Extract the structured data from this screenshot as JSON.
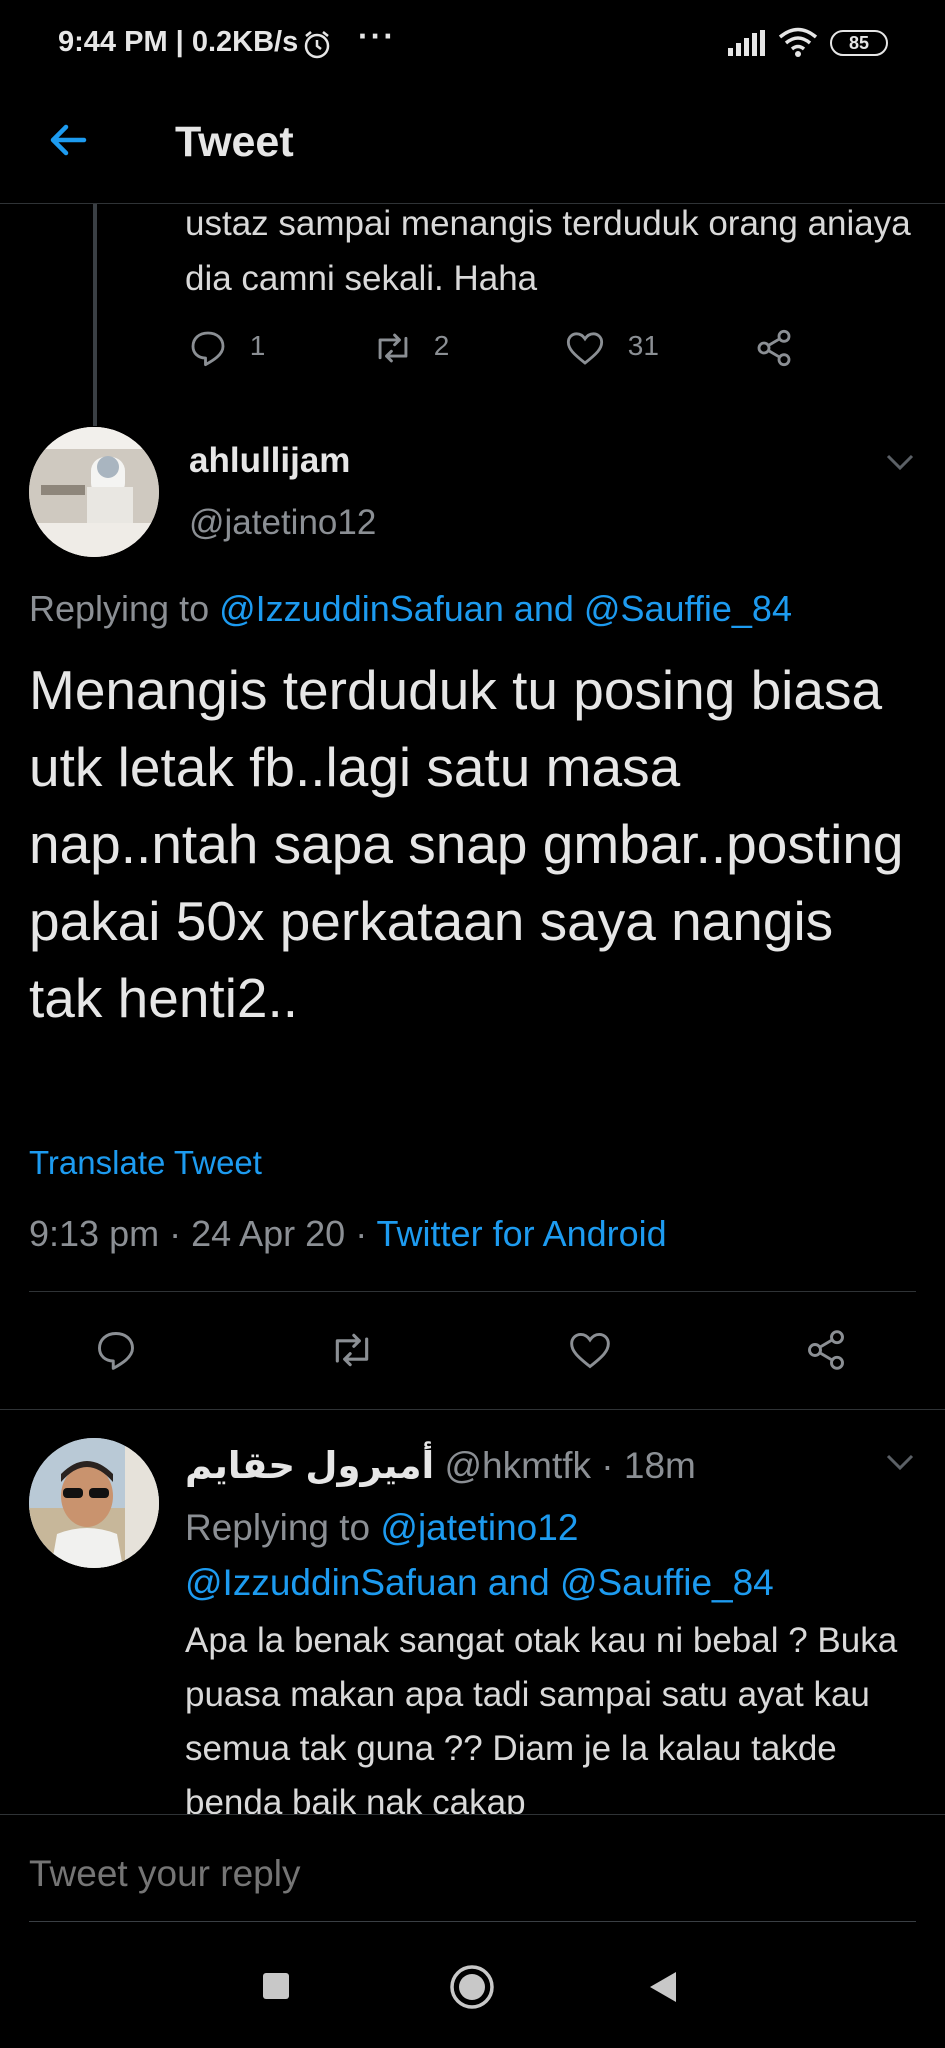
{
  "status_bar": {
    "time": "9:44 PM | 0.2KB/s",
    "dots": "···",
    "battery": "85"
  },
  "header": {
    "title": "Tweet"
  },
  "previous_tweet": {
    "text": "ustaz sampai menangis terduduk orang aniaya dia camni sekali. Haha",
    "replies": "1",
    "retweets": "2",
    "likes": "31"
  },
  "main_tweet": {
    "name": "ahlullijam",
    "handle": "@jatetino12",
    "replying_prefix": "Replying to ",
    "replying_user1": "@IzzuddinSafuan",
    "replying_and": " and ",
    "replying_user2": "@Sauffie_84",
    "text": "Menangis terduduk tu posing biasa utk letak fb..lagi satu masa nap..ntah sapa snap gmbar..posting pakai 50x perkataan saya nangis tak henti2..",
    "translate": "Translate Tweet",
    "time": "9:13 pm · 24 Apr 20 · ",
    "source": "Twitter for Android"
  },
  "reply_tweet": {
    "name": "أميرول حقايم",
    "handle": "@hkmtfk",
    "age": " · 18m",
    "replying_prefix": "Replying to ",
    "replying_user1": "@jatetino12",
    "replying_user2": "@IzzuddinSafuan",
    "replying_and": " and ",
    "replying_user3": "@Sauffie_84",
    "text": "Apa la benak sangat otak kau ni bebal ? Buka puasa makan apa tadi sampai satu ayat kau semua tak guna ?? Diam je la kalau takde benda baik nak cakap"
  },
  "compose": {
    "placeholder": "Tweet your reply"
  },
  "colors": {
    "accent": "#1d9bf0",
    "background": "#000000",
    "secondary_text": "#8b8f94"
  }
}
